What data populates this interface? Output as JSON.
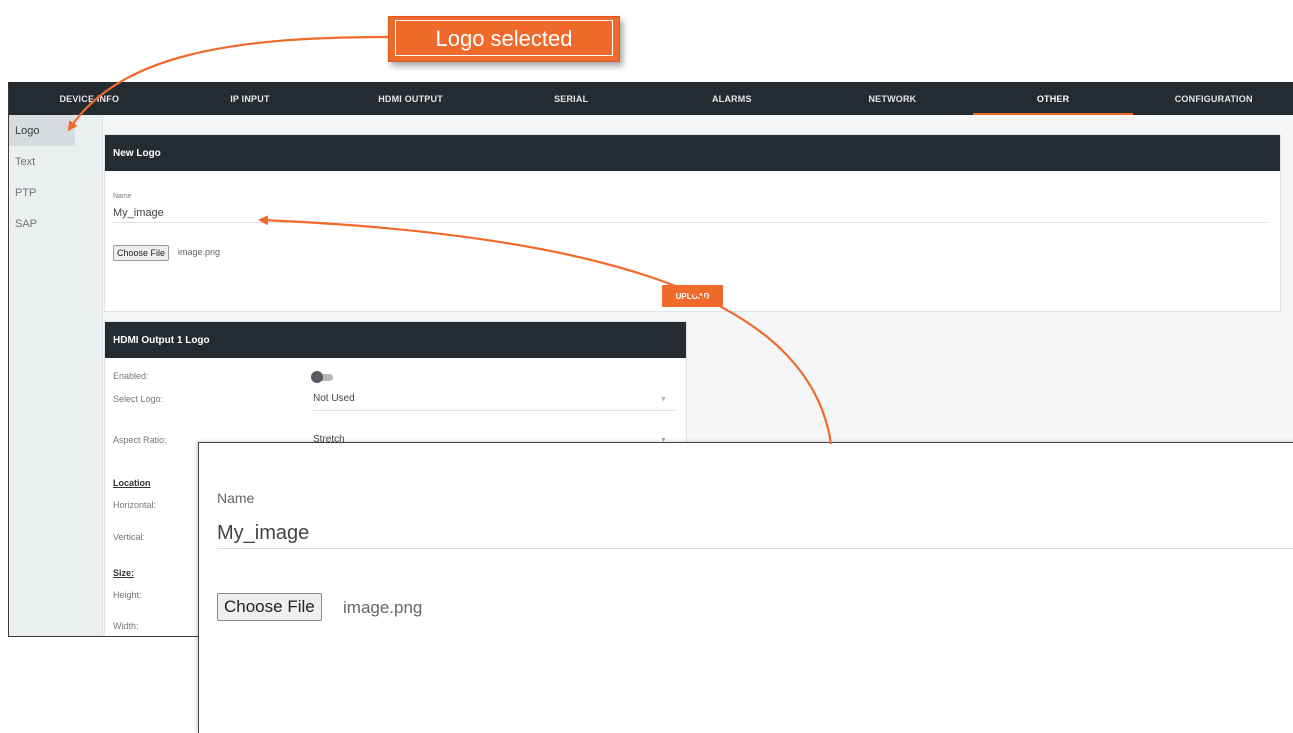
{
  "callout": {
    "text": "Logo selected"
  },
  "topnav": {
    "tabs": [
      {
        "label": "DEVICE INFO"
      },
      {
        "label": "IP INPUT"
      },
      {
        "label": "HDMI OUTPUT"
      },
      {
        "label": "SERIAL"
      },
      {
        "label": "ALARMS"
      },
      {
        "label": "NETWORK"
      },
      {
        "label": "OTHER",
        "active": true
      },
      {
        "label": "CONFIGURATION"
      }
    ]
  },
  "sidebar": {
    "items": [
      {
        "label": "Logo",
        "active": true
      },
      {
        "label": "Text"
      },
      {
        "label": "PTP"
      },
      {
        "label": "SAP"
      }
    ]
  },
  "new_logo": {
    "title": "New Logo",
    "name_label": "Name",
    "name_value": "My_image",
    "choose_file": "Choose File",
    "file_name": "image.png",
    "upload": "UPLOAD"
  },
  "hdmi_logo": {
    "title": "HDMI Output 1 Logo",
    "enabled_label": "Enabled:",
    "enabled": false,
    "select_logo_label": "Select Logo:",
    "select_logo_value": "Not Used",
    "aspect_label": "Aspect Ratio:",
    "aspect_value": "Stretch",
    "location_label": "Location",
    "horizontal_label": "Horizontal:",
    "vertical_label": "Vertical:",
    "size_label": "Size:",
    "height_label": "Height:",
    "width_label": "Width:"
  },
  "zoom": {
    "name_label": "Name",
    "name_value": "My_image",
    "choose_file": "Choose File",
    "file_name": "image.png"
  },
  "colors": {
    "accent": "#ef6a2b",
    "header": "#242b31"
  }
}
